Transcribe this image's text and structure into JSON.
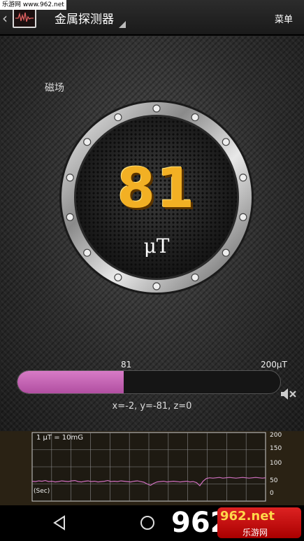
{
  "watermark_top": "乐游网 www.962.net",
  "header": {
    "title": "金属探测器",
    "menu_label": "菜单"
  },
  "field_label": "磁场",
  "gauge": {
    "reading": "81",
    "unit": "μT"
  },
  "bar": {
    "value_label": "81",
    "max_label": "200μT",
    "fraction": 0.405
  },
  "xyz": "x=-2, y=-81, z=0",
  "graph": {
    "scale_label": "1 μT = 10mG",
    "time_label": "(Sec)",
    "y_ticks": [
      "200",
      "150",
      "100",
      "50",
      "0"
    ],
    "trace": [
      58,
      57,
      59,
      58,
      60,
      57,
      58,
      56,
      57,
      59,
      58,
      57,
      59,
      60,
      57,
      56,
      58,
      59,
      57,
      58,
      56,
      57,
      58,
      60,
      57,
      58,
      57,
      59,
      58,
      57,
      56,
      58,
      59,
      57,
      55,
      50,
      46,
      52,
      56,
      57,
      58,
      56,
      57,
      58,
      57,
      56,
      57,
      58,
      56,
      57,
      54,
      45,
      58,
      66,
      68,
      67,
      68,
      69,
      67,
      68,
      69,
      68,
      67,
      68,
      69,
      68,
      67,
      68,
      69,
      68,
      67,
      68
    ]
  },
  "watermark_bottom": {
    "big": "962",
    "logo_a": "962.net",
    "logo_b": "乐游网",
    "logo_c": "乐游网"
  },
  "colors": {
    "gold": "#f2b024",
    "bar_fill": "#c060b0",
    "trace": "#d070c0"
  },
  "icons": {
    "back": "chevron-left-icon",
    "mute": "speaker-mute-icon",
    "nav_back": "triangle-back-icon",
    "nav_home": "circle-home-icon"
  }
}
